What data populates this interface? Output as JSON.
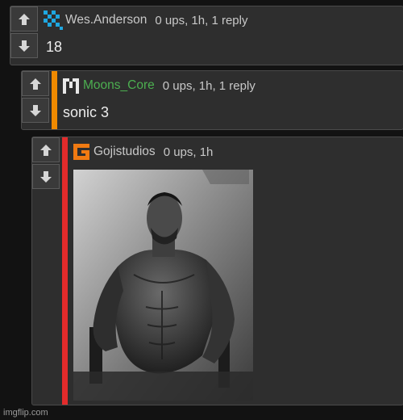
{
  "comments": [
    {
      "username": "Wes.Anderson",
      "username_color": "#c8c8c8",
      "meta": "0 ups, 1h, 1 reply",
      "text": "18",
      "avatar_icon": "checker-pattern-icon",
      "accent_color": "#1fa7e0"
    },
    {
      "username": "Moons_Core",
      "username_color": "#4caf50",
      "meta": "0 ups, 1h, 1 reply",
      "text": "sonic 3",
      "avatar_icon": "pixel-m-icon",
      "thread_color": "#f08a00"
    },
    {
      "username": "Gojistudios",
      "username_color": "#c8c8c8",
      "meta": "0 ups, 1h",
      "avatar_icon": "orange-g-icon",
      "thread_color": "#e32b2b",
      "image_icon": "bodybuilder-photo-icon"
    }
  ],
  "vote_icons": {
    "up": "arrow-up-icon",
    "down": "arrow-down-icon"
  },
  "watermark": "imgflip.com"
}
